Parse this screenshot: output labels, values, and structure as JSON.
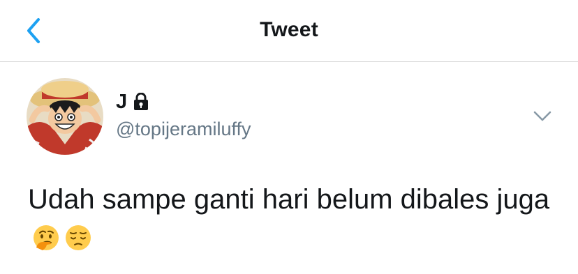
{
  "header": {
    "title": "Tweet",
    "back_icon": "chevron-left-icon",
    "accent_color": "#1da1f2"
  },
  "author": {
    "display_name": "J",
    "handle": "@topijeramiluffy",
    "protected_icon": "lock-icon"
  },
  "tweet": {
    "text": "Udah sampe ganti hari belum dibales juga",
    "emojis": [
      "thinking-face-emoji",
      "pensive-face-emoji"
    ]
  },
  "menu_icon": "chevron-down-icon"
}
